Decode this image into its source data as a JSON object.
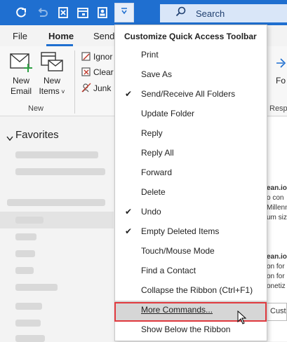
{
  "search": {
    "label": "Search"
  },
  "menu": {
    "tabs": [
      "File",
      "Home",
      "Send"
    ]
  },
  "ribbon": {
    "new_email": "New\nEmail",
    "new_items": "New\nItems",
    "group_new": "New",
    "ignore": "Ignor",
    "clean": "Clear",
    "junk": "Junk",
    "right_label": "Resp",
    "right_partial_1": "Fo"
  },
  "favorites": {
    "header": "Favorites"
  },
  "dropdown": {
    "title": "Customize Quick Access Toolbar",
    "items": [
      {
        "label": "Print",
        "checked": false
      },
      {
        "label": "Save As",
        "checked": false
      },
      {
        "label": "Send/Receive All Folders",
        "checked": true
      },
      {
        "label": "Update Folder",
        "checked": false
      },
      {
        "label": "Reply",
        "checked": false
      },
      {
        "label": "Reply All",
        "checked": false
      },
      {
        "label": "Forward",
        "checked": false
      },
      {
        "label": "Delete",
        "checked": false
      },
      {
        "label": "Undo",
        "checked": true
      },
      {
        "label": "Empty Deleted Items",
        "checked": true
      },
      {
        "label": "Touch/Mouse Mode",
        "checked": false
      },
      {
        "label": "Find a Contact",
        "checked": false
      },
      {
        "label": "Collapse the Ribbon (Ctrl+F1)",
        "checked": false
      },
      {
        "label": "More Commands...",
        "checked": false
      },
      {
        "label": "Show Below the Ribbon",
        "checked": false
      }
    ],
    "check_glyph": "✔"
  },
  "right_snippets": [
    "ean.io",
    "o con",
    "Millenn",
    "um siz",
    "ean.io",
    "on for",
    "on for",
    "onetiz"
  ],
  "cust_label": "Cust",
  "colors": {
    "accent": "#1f6fd0",
    "highlight_border": "#e0393e"
  },
  "icons": [
    "refresh-icon",
    "undo-icon",
    "excel-icon",
    "calendar-icon",
    "contact-icon",
    "chevron-down-icon",
    "search-icon",
    "mail-icon",
    "calendar-add-icon",
    "cursor-icon"
  ]
}
